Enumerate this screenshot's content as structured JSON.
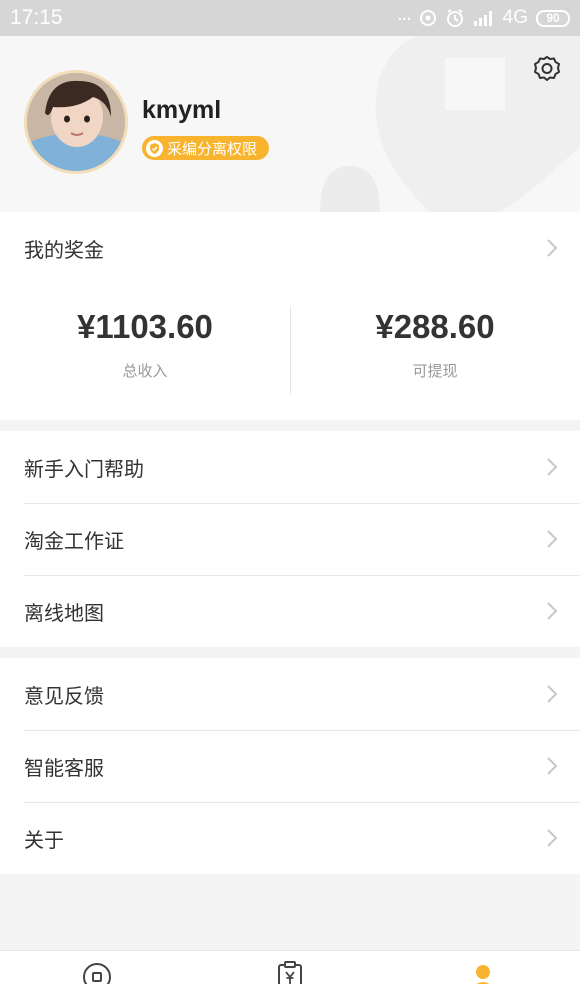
{
  "status_bar": {
    "time": "17:15",
    "network": "4G",
    "battery": "90"
  },
  "profile": {
    "username": "kmyml",
    "badge": "采编分离权限",
    "avatar_alt": "avatar"
  },
  "bonus": {
    "title": "我的奖金",
    "total_income_value": "¥1103.60",
    "total_income_label": "总收入",
    "withdrawable_value": "¥288.60",
    "withdrawable_label": "可提现"
  },
  "menu_group_1": [
    {
      "label": "新手入门帮助"
    },
    {
      "label": "淘金工作证"
    },
    {
      "label": "离线地图"
    }
  ],
  "menu_group_2": [
    {
      "label": "意见反馈"
    },
    {
      "label": "智能客服"
    },
    {
      "label": "关于"
    }
  ],
  "tabbar": {
    "tabs": [
      {
        "icon": "home-circle-icon",
        "active": false
      },
      {
        "icon": "clipboard-yen-icon",
        "active": false
      },
      {
        "icon": "person-icon",
        "active": true
      }
    ]
  },
  "colors": {
    "accent": "#f8b42e",
    "text_primary": "#333333",
    "text_secondary": "#999999",
    "chevron": "#c8c8c8"
  }
}
